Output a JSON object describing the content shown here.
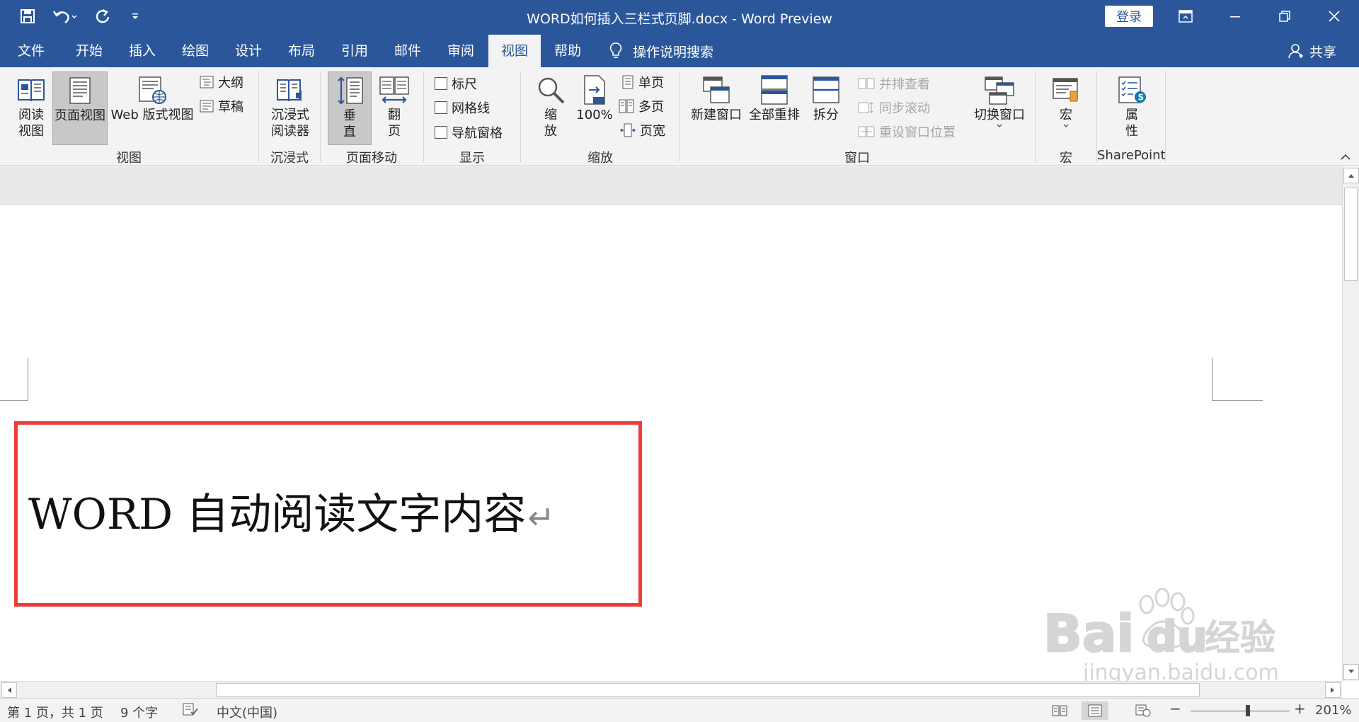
{
  "window": {
    "title": "WORD如何插入三栏式页脚.docx  -  Word Preview",
    "login_label": "登录"
  },
  "tabs": [
    "文件",
    "开始",
    "插入",
    "绘图",
    "设计",
    "布局",
    "引用",
    "邮件",
    "审阅",
    "视图",
    "帮助"
  ],
  "active_tab": "视图",
  "tell_me": "操作说明搜索",
  "share": "共享",
  "ribbon": {
    "views": {
      "label": "视图",
      "read_mode": "阅读\n视图",
      "print_layout": "页面视图",
      "web_layout": "Web 版式视图",
      "outline": "大纲",
      "draft": "草稿"
    },
    "immersive": {
      "label": "沉浸式",
      "immersive_reader": "沉浸式\n阅读器"
    },
    "page_movement": {
      "label": "页面移动",
      "vertical": "垂\n直",
      "side_to_side": "翻\n页"
    },
    "show": {
      "label": "显示",
      "ruler": "标尺",
      "gridlines": "网格线",
      "nav_pane": "导航窗格"
    },
    "zoom": {
      "label": "缩放",
      "zoom": "缩\n放",
      "hundred": "100%",
      "one_page": "单页",
      "multi_page": "多页",
      "page_width": "页宽"
    },
    "window": {
      "label": "窗口",
      "new_window": "新建窗口",
      "arrange_all": "全部重排",
      "split": "拆分",
      "side_by_side": "并排查看",
      "sync_scroll": "同步滚动",
      "reset_position": "重设窗口位置",
      "switch_windows": "切换窗口"
    },
    "macros": {
      "label": "宏",
      "macros": "宏"
    },
    "sharepoint": {
      "label": "SharePoint",
      "properties": "属\n性"
    }
  },
  "document": {
    "text": "WORD 自动阅读文字内容",
    "para_mark": "↵"
  },
  "status": {
    "page": "第 1 页，共 1 页",
    "words": "9 个字",
    "language": "中文(中国)",
    "zoom_minus": "−",
    "zoom_plus": "+",
    "zoom_level": "201%"
  },
  "watermark": {
    "brand": "Bai",
    "brand2": "du",
    "cn": "经验",
    "url": "jingyan.baidu.com"
  },
  "colors": {
    "accent": "#2b579a",
    "ribbon_bg": "#f3f3f3",
    "highlight": "#ee3b3b"
  }
}
